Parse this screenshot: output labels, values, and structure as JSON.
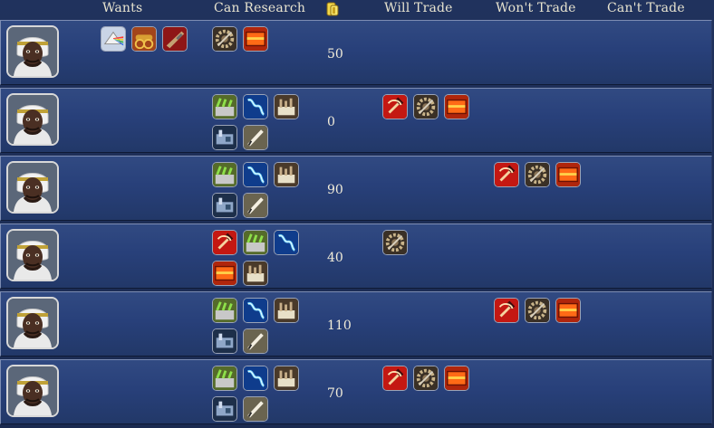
{
  "headers": {
    "wants": "Wants",
    "can_research": "Can Research",
    "will_trade": "Will Trade",
    "wont_trade": "Won't Trade",
    "cant_trade": "Can't Trade"
  },
  "icon_names": {
    "gold": "gold-coins-icon",
    "tech_prism": "rainbow-prism-tech-icon",
    "tech_cannon": "cannon-tech-icon",
    "tech_rifle": "rifle-tech-icon",
    "tech_gear": "gear-machinery-tech-icon",
    "tech_furnace": "furnace-steel-tech-icon",
    "tech_farm": "fertilizer-farm-tech-icon",
    "tech_electric": "electricity-tech-icon",
    "tech_factory": "factory-tech-icon",
    "tech_engine": "steam-engine-tech-icon",
    "tech_pen": "quill-writing-tech-icon",
    "tech_hammer_sickle": "communism-tech-icon"
  },
  "colors": {
    "header_text": "#e8e4d0",
    "row_top": "#314a82",
    "row_bottom": "#223868",
    "border_light": "#7d8db3"
  },
  "rows": [
    {
      "leader": "leader-portrait",
      "wants": [
        "prism",
        "cannon",
        "rifle"
      ],
      "can_research": [
        "gear",
        "furnace"
      ],
      "gold": "50",
      "will_trade": [],
      "wont_trade": [],
      "cant_trade": []
    },
    {
      "leader": "leader-portrait",
      "wants": [],
      "can_research": [
        "farm",
        "electric",
        "factory",
        "engine",
        "pen"
      ],
      "gold": "0",
      "will_trade": [
        "hammer",
        "gear",
        "furnace"
      ],
      "wont_trade": [],
      "cant_trade": []
    },
    {
      "leader": "leader-portrait",
      "wants": [],
      "can_research": [
        "farm",
        "electric",
        "factory",
        "engine",
        "pen"
      ],
      "gold": "90",
      "will_trade": [],
      "wont_trade": [
        "hammer",
        "gear",
        "furnace"
      ],
      "cant_trade": []
    },
    {
      "leader": "leader-portrait",
      "wants": [],
      "can_research": [
        "hammer",
        "farm",
        "electric",
        "furnace",
        "factory"
      ],
      "gold": "40",
      "will_trade": [
        "gear"
      ],
      "wont_trade": [],
      "cant_trade": []
    },
    {
      "leader": "leader-portrait",
      "wants": [],
      "can_research": [
        "farm",
        "electric",
        "factory",
        "engine",
        "pen"
      ],
      "gold": "110",
      "will_trade": [],
      "wont_trade": [
        "hammer",
        "gear",
        "furnace"
      ],
      "cant_trade": []
    },
    {
      "leader": "leader-portrait",
      "wants": [],
      "can_research": [
        "farm",
        "electric",
        "factory",
        "engine",
        "pen"
      ],
      "gold": "70",
      "will_trade": [
        "hammer",
        "gear",
        "furnace"
      ],
      "wont_trade": [],
      "cant_trade": []
    }
  ]
}
